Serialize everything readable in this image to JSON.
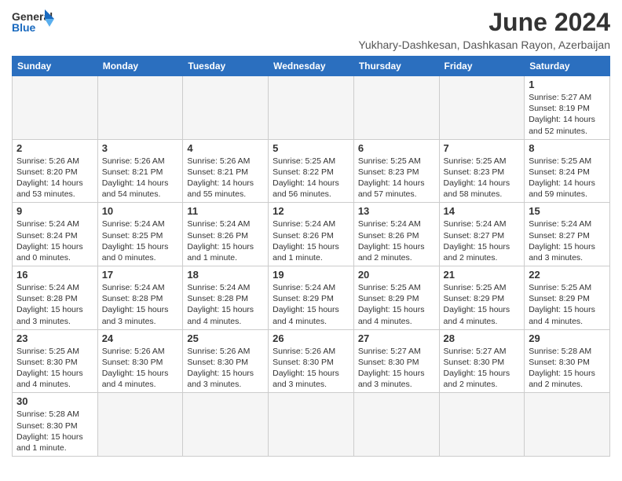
{
  "header": {
    "logo_general": "General",
    "logo_blue": "Blue",
    "month_title": "June 2024",
    "subtitle": "Yukhary-Dashkesan, Dashkasan Rayon, Azerbaijan"
  },
  "weekdays": [
    "Sunday",
    "Monday",
    "Tuesday",
    "Wednesday",
    "Thursday",
    "Friday",
    "Saturday"
  ],
  "weeks": [
    [
      {
        "day": "",
        "info": ""
      },
      {
        "day": "",
        "info": ""
      },
      {
        "day": "",
        "info": ""
      },
      {
        "day": "",
        "info": ""
      },
      {
        "day": "",
        "info": ""
      },
      {
        "day": "",
        "info": ""
      },
      {
        "day": "1",
        "info": "Sunrise: 5:27 AM\nSunset: 8:19 PM\nDaylight: 14 hours\nand 52 minutes."
      }
    ],
    [
      {
        "day": "2",
        "info": "Sunrise: 5:26 AM\nSunset: 8:20 PM\nDaylight: 14 hours\nand 53 minutes."
      },
      {
        "day": "3",
        "info": "Sunrise: 5:26 AM\nSunset: 8:21 PM\nDaylight: 14 hours\nand 54 minutes."
      },
      {
        "day": "4",
        "info": "Sunrise: 5:26 AM\nSunset: 8:21 PM\nDaylight: 14 hours\nand 55 minutes."
      },
      {
        "day": "5",
        "info": "Sunrise: 5:25 AM\nSunset: 8:22 PM\nDaylight: 14 hours\nand 56 minutes."
      },
      {
        "day": "6",
        "info": "Sunrise: 5:25 AM\nSunset: 8:23 PM\nDaylight: 14 hours\nand 57 minutes."
      },
      {
        "day": "7",
        "info": "Sunrise: 5:25 AM\nSunset: 8:23 PM\nDaylight: 14 hours\nand 58 minutes."
      },
      {
        "day": "8",
        "info": "Sunrise: 5:25 AM\nSunset: 8:24 PM\nDaylight: 14 hours\nand 59 minutes."
      }
    ],
    [
      {
        "day": "9",
        "info": "Sunrise: 5:24 AM\nSunset: 8:24 PM\nDaylight: 15 hours\nand 0 minutes."
      },
      {
        "day": "10",
        "info": "Sunrise: 5:24 AM\nSunset: 8:25 PM\nDaylight: 15 hours\nand 0 minutes."
      },
      {
        "day": "11",
        "info": "Sunrise: 5:24 AM\nSunset: 8:26 PM\nDaylight: 15 hours\nand 1 minute."
      },
      {
        "day": "12",
        "info": "Sunrise: 5:24 AM\nSunset: 8:26 PM\nDaylight: 15 hours\nand 1 minute."
      },
      {
        "day": "13",
        "info": "Sunrise: 5:24 AM\nSunset: 8:26 PM\nDaylight: 15 hours\nand 2 minutes."
      },
      {
        "day": "14",
        "info": "Sunrise: 5:24 AM\nSunset: 8:27 PM\nDaylight: 15 hours\nand 2 minutes."
      },
      {
        "day": "15",
        "info": "Sunrise: 5:24 AM\nSunset: 8:27 PM\nDaylight: 15 hours\nand 3 minutes."
      }
    ],
    [
      {
        "day": "16",
        "info": "Sunrise: 5:24 AM\nSunset: 8:28 PM\nDaylight: 15 hours\nand 3 minutes."
      },
      {
        "day": "17",
        "info": "Sunrise: 5:24 AM\nSunset: 8:28 PM\nDaylight: 15 hours\nand 3 minutes."
      },
      {
        "day": "18",
        "info": "Sunrise: 5:24 AM\nSunset: 8:28 PM\nDaylight: 15 hours\nand 4 minutes."
      },
      {
        "day": "19",
        "info": "Sunrise: 5:24 AM\nSunset: 8:29 PM\nDaylight: 15 hours\nand 4 minutes."
      },
      {
        "day": "20",
        "info": "Sunrise: 5:25 AM\nSunset: 8:29 PM\nDaylight: 15 hours\nand 4 minutes."
      },
      {
        "day": "21",
        "info": "Sunrise: 5:25 AM\nSunset: 8:29 PM\nDaylight: 15 hours\nand 4 minutes."
      },
      {
        "day": "22",
        "info": "Sunrise: 5:25 AM\nSunset: 8:29 PM\nDaylight: 15 hours\nand 4 minutes."
      }
    ],
    [
      {
        "day": "23",
        "info": "Sunrise: 5:25 AM\nSunset: 8:30 PM\nDaylight: 15 hours\nand 4 minutes."
      },
      {
        "day": "24",
        "info": "Sunrise: 5:26 AM\nSunset: 8:30 PM\nDaylight: 15 hours\nand 4 minutes."
      },
      {
        "day": "25",
        "info": "Sunrise: 5:26 AM\nSunset: 8:30 PM\nDaylight: 15 hours\nand 3 minutes."
      },
      {
        "day": "26",
        "info": "Sunrise: 5:26 AM\nSunset: 8:30 PM\nDaylight: 15 hours\nand 3 minutes."
      },
      {
        "day": "27",
        "info": "Sunrise: 5:27 AM\nSunset: 8:30 PM\nDaylight: 15 hours\nand 3 minutes."
      },
      {
        "day": "28",
        "info": "Sunrise: 5:27 AM\nSunset: 8:30 PM\nDaylight: 15 hours\nand 2 minutes."
      },
      {
        "day": "29",
        "info": "Sunrise: 5:28 AM\nSunset: 8:30 PM\nDaylight: 15 hours\nand 2 minutes."
      }
    ],
    [
      {
        "day": "30",
        "info": "Sunrise: 5:28 AM\nSunset: 8:30 PM\nDaylight: 15 hours\nand 1 minute."
      },
      {
        "day": "",
        "info": ""
      },
      {
        "day": "",
        "info": ""
      },
      {
        "day": "",
        "info": ""
      },
      {
        "day": "",
        "info": ""
      },
      {
        "day": "",
        "info": ""
      },
      {
        "day": "",
        "info": ""
      }
    ]
  ]
}
